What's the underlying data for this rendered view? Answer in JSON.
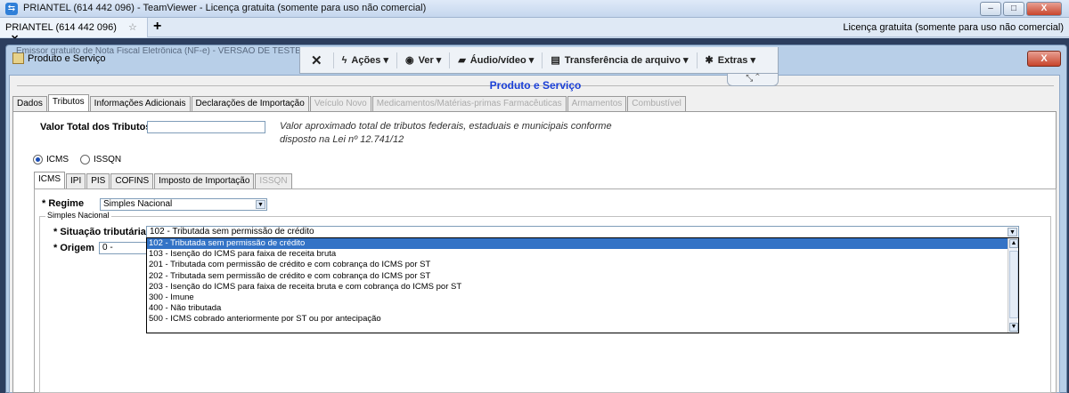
{
  "tv_window": {
    "title": "PRIANTEL (614 442 096) - TeamViewer - Licença gratuita (somente para uso não comercial)",
    "tab_label": "PRIANTEL (614 442 096)",
    "license": "Licença gratuita (somente para uso não comercial)",
    "controls": [
      "–",
      "□",
      "X"
    ]
  },
  "tv_toolbar": {
    "close": "✕",
    "items": [
      "Ações ▾",
      "Ver ▾",
      "Áudio/vídeo ▾",
      "Transferência de arquivo ▾",
      "Extras ▾"
    ],
    "mini": "⤡ ⌃"
  },
  "app_window": {
    "title": "Produto e Serviço",
    "background_blur": "Emissor gratuito de Nota Fiscal Eletrônica (NF-e) - VERSÃO DE TESTE",
    "close": "X"
  },
  "panel": {
    "title": "Produto e Serviço"
  },
  "tabs": [
    "Dados",
    "Tributos",
    "Informações Adicionais",
    "Declarações de Importação",
    "Veículo Novo",
    "Medicamentos/Matérias-primas Farmacêuticas",
    "Armamentos",
    "Combustível"
  ],
  "tributos": {
    "valor_total_label": "Valor Total dos Tributos",
    "valor_total_value": "",
    "note": "Valor aproximado total de tributos federais, estaduais e municipais conforme disposto na Lei nº 12.741/12",
    "radio_icms": "ICMS",
    "radio_issqn": "ISSQN",
    "subtabs": [
      "ICMS",
      "IPI",
      "PIS",
      "COFINS",
      "Imposto de Importação",
      "ISSQN"
    ],
    "regime_label": "* Regime",
    "regime_value": "Simples Nacional",
    "fieldset_legend": "Simples Nacional",
    "situacao_label": "* Situação tributária",
    "situacao_value": "102 - Tributada sem permissão de crédito",
    "origem_label": "* Origem",
    "origem_value": "0 - Nacional,",
    "options": [
      "102 - Tributada sem permissão de crédito",
      "103 - Isenção do ICMS para faixa de receita bruta",
      "201 - Tributada com permissão de crédito e com cobrança do ICMS por ST",
      "202 - Tributada sem permissão de crédito e com cobrança do ICMS por ST",
      "203 - Isenção do ICMS para faixa de receita bruta e com cobrança do ICMS por ST",
      "300 - Imune",
      "400 - Não tributada",
      "500 - ICMS cobrado anteriormente por ST ou por antecipação"
    ]
  }
}
